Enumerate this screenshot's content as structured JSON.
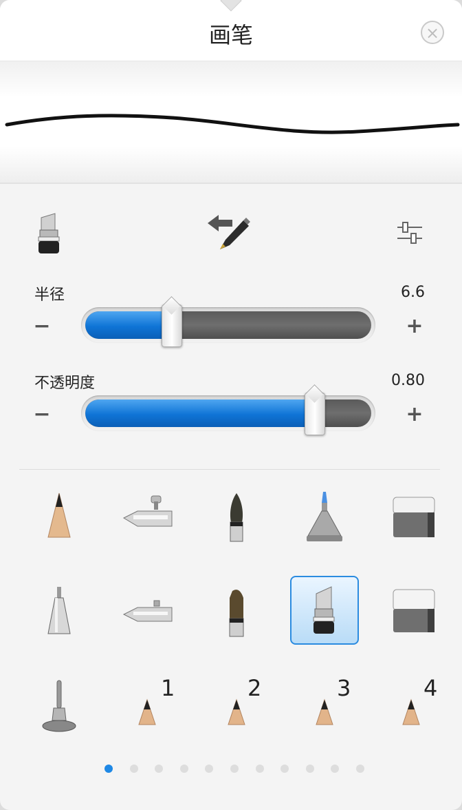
{
  "header": {
    "title": "画笔",
    "close_label": "×"
  },
  "toolbar": {
    "items": [
      {
        "icon": "brush-tip-icon"
      },
      {
        "icon": "swap-brush-icon"
      },
      {
        "icon": "settings-sliders-icon"
      }
    ]
  },
  "radius": {
    "label": "半径",
    "value": "6.6",
    "fraction": 0.3,
    "minus": "−",
    "plus": "+"
  },
  "opacity": {
    "label": "不透明度",
    "value": "0.80",
    "fraction": 0.8,
    "minus": "−",
    "plus": "+"
  },
  "brushes": [
    {
      "icon": "pencil-icon"
    },
    {
      "icon": "airbrush-icon"
    },
    {
      "icon": "paintbrush-icon"
    },
    {
      "icon": "marker-icon"
    },
    {
      "icon": "eraser-icon"
    },
    {
      "icon": "ballpoint-icon"
    },
    {
      "icon": "airbrush-2-icon"
    },
    {
      "icon": "flat-brush-icon"
    },
    {
      "icon": "chisel-marker-icon",
      "selected": true
    },
    {
      "icon": "eraser-2-icon"
    },
    {
      "icon": "smudge-icon"
    },
    {
      "icon": "custom-brush-1-icon",
      "number": "1"
    },
    {
      "icon": "custom-brush-2-icon",
      "number": "2"
    },
    {
      "icon": "custom-brush-3-icon",
      "number": "3"
    },
    {
      "icon": "custom-brush-4-icon",
      "number": "4"
    }
  ],
  "pagination": {
    "total": 11,
    "active": 0
  },
  "colors": {
    "accent": "#1e88e5",
    "selection_border": "#2a8be0"
  }
}
